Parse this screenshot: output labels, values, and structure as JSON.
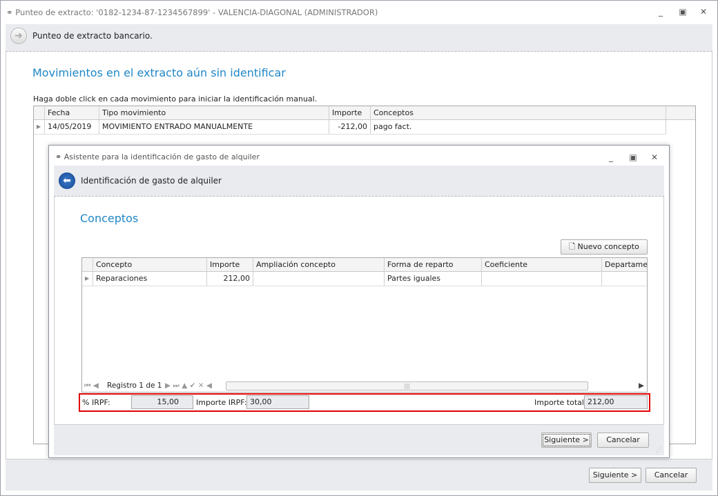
{
  "window": {
    "title": "Punteo de extracto: '0182-1234-87-1234567899' - VALENCIA-DIAGONAL (ADMINISTRADOR)",
    "header": "Punteo de extracto bancario.",
    "heading": "Movimientos en el extracto aún sin identificar",
    "instruction": "Haga doble click en cada movimiento para iniciar la identificación manual.",
    "columns": [
      "Fecha",
      "Tipo movimiento",
      "Importe",
      "Conceptos"
    ],
    "rows": [
      {
        "fecha": "14/05/2019",
        "tipo": "MOVIMIENTO ENTRADO MANUALMENTE",
        "importe": "-212,00",
        "conceptos": "pago fact."
      }
    ],
    "next_label": "Siguiente >",
    "cancel_label": "Cancelar"
  },
  "dialog": {
    "title": "Asistente para la identificación de gasto de alquiler",
    "header": "Identificación de gasto de alquiler",
    "heading": "Conceptos",
    "new_label": "Nuevo concepto",
    "columns": [
      "Concepto",
      "Importe",
      "Ampliación concepto",
      "Forma de reparto",
      "Coeficiente",
      "Departament"
    ],
    "rows": [
      {
        "concepto": "Reparaciones",
        "importe": "212,00",
        "ampliacion": "",
        "forma": "Partes iguales",
        "coeficiente": "",
        "departamento": ""
      }
    ],
    "navigator": "Registro 1 de 1",
    "irpf_label": "% IRPF:",
    "irpf_value": "15,00",
    "importe_irpf_label": "Importe IRPF:",
    "importe_irpf_value": "30,00",
    "total_label": "Importe total:",
    "total_value": "212,00",
    "next_label": "Siguiente >",
    "cancel_label": "Cancelar"
  },
  "colors": {
    "accent": "#1f86c6",
    "highlight": "#e00000"
  }
}
